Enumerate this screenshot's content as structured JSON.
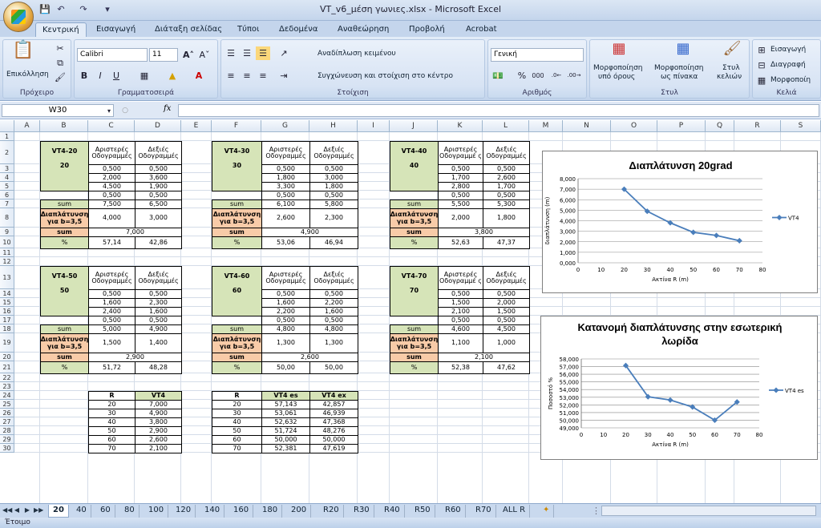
{
  "window": {
    "title": "VT_v6_μέση γωνιες.xlsx - Microsoft Excel"
  },
  "tabs": [
    "Κεντρική",
    "Εισαγωγή",
    "Διάταξη σελίδας",
    "Τύποι",
    "Δεδομένα",
    "Αναθεώρηση",
    "Προβολή",
    "Acrobat"
  ],
  "ribbon": {
    "clipboard": {
      "paste": "Επικόλληση",
      "name": "Πρόχειρο"
    },
    "font": {
      "family": "Calibri",
      "size": "11",
      "name": "Γραμματοσειρά"
    },
    "alignment": {
      "wrap": "Αναδίπλωση κειμένου",
      "merge": "Συγχώνευση και στοίχιση στο κέντρο",
      "name": "Στοίχιση"
    },
    "number": {
      "format": "Γενική",
      "name": "Αριθμός"
    },
    "styles": {
      "cond1": "Μορφοποίηση",
      "cond2": "υπό όρους",
      "table1": "Μορφοποίηση",
      "table2": "ως πίνακα",
      "cell1": "Στυλ",
      "cell2": "κελιών",
      "name": "Στυλ"
    },
    "cells": {
      "insert": "Εισαγωγή",
      "delete": "Διαγραφή",
      "format": "Μορφοποίη",
      "name": "Κελιά"
    }
  },
  "formula_bar": {
    "namebox": "W30",
    "fx": "fx",
    "value": ""
  },
  "columns": [
    "A",
    "B",
    "C",
    "D",
    "E",
    "F",
    "G",
    "H",
    "I",
    "J",
    "K",
    "L",
    "M",
    "N",
    "O",
    "P",
    "Q",
    "R",
    "S"
  ],
  "rows": [
    "1",
    "2",
    "3",
    "4",
    "5",
    "6",
    "7",
    "8",
    "9",
    "10",
    "11",
    "12",
    "13",
    "14",
    "15",
    "16",
    "17",
    "18",
    "19",
    "20",
    "21",
    "22",
    "23",
    "24",
    "25",
    "26",
    "27",
    "28",
    "29",
    "30"
  ],
  "labels": {
    "left": "Αριστερές Οδογραμμές",
    "right": "Δεξιές Οδογραμμές",
    "left_wrap": "Αριστερές Οδογραμμέ ς",
    "sum": "sum",
    "widen": "Διαπλάτυνση για b=3,5",
    "pct": "%"
  },
  "blocks": [
    {
      "name": "VT4-20",
      "r": "20",
      "left": [
        "0,500",
        "2,000",
        "4,500",
        "0,500"
      ],
      "right": [
        "0,500",
        "3,600",
        "1,900",
        "0,500"
      ],
      "sumL": "7,500",
      "sumR": "6,500",
      "wL": "4,000",
      "wR": "3,000",
      "total": "7,000",
      "pL": "57,14",
      "pR": "42,86"
    },
    {
      "name": "VT4-30",
      "r": "30",
      "left": [
        "0,500",
        "1,800",
        "3,300",
        "0,500"
      ],
      "right": [
        "0,500",
        "3,000",
        "1,800",
        "0,500"
      ],
      "sumL": "6,100",
      "sumR": "5,800",
      "wL": "2,600",
      "wR": "2,300",
      "total": "4,900",
      "pL": "53,06",
      "pR": "46,94"
    },
    {
      "name": "VT4-40",
      "r": "40",
      "left": [
        "0,500",
        "1,700",
        "2,800",
        "0,500"
      ],
      "right": [
        "0,500",
        "2,600",
        "1,700",
        "0,500"
      ],
      "sumL": "5,500",
      "sumR": "5,300",
      "wL": "2,000",
      "wR": "1,800",
      "total": "3,800",
      "pL": "52,63",
      "pR": "47,37"
    },
    {
      "name": "VT4-50",
      "r": "50",
      "left": [
        "0,500",
        "1,600",
        "2,400",
        "0,500"
      ],
      "right": [
        "0,500",
        "2,300",
        "1,600",
        "0,500"
      ],
      "sumL": "5,000",
      "sumR": "4,900",
      "wL": "1,500",
      "wR": "1,400",
      "total": "2,900",
      "pL": "51,72",
      "pR": "48,28"
    },
    {
      "name": "VT4-60",
      "r": "60",
      "left": [
        "0,500",
        "1,600",
        "2,200",
        "0,500"
      ],
      "right": [
        "0,500",
        "2,200",
        "1,600",
        "0,500"
      ],
      "sumL": "4,800",
      "sumR": "4,800",
      "wL": "1,300",
      "wR": "1,300",
      "total": "2,600",
      "pL": "50,00",
      "pR": "50,00"
    },
    {
      "name": "VT4-70",
      "r": "70",
      "left": [
        "0,500",
        "1,500",
        "2,100",
        "0,500"
      ],
      "right": [
        "0,500",
        "2,000",
        "1,500",
        "0,500"
      ],
      "sumL": "4,600",
      "sumR": "4,500",
      "wL": "1,100",
      "wR": "1,000",
      "total": "2,100",
      "pL": "52,38",
      "pR": "47,62"
    }
  ],
  "table1": {
    "headers": [
      "R",
      "VT4"
    ],
    "rows": [
      [
        "20",
        "7,000"
      ],
      [
        "30",
        "4,900"
      ],
      [
        "40",
        "3,800"
      ],
      [
        "50",
        "2,900"
      ],
      [
        "60",
        "2,600"
      ],
      [
        "70",
        "2,100"
      ]
    ]
  },
  "table2": {
    "headers": [
      "R",
      "VT4 es",
      "VT4 ex"
    ],
    "rows": [
      [
        "20",
        "57,143",
        "42,857"
      ],
      [
        "30",
        "53,061",
        "46,939"
      ],
      [
        "40",
        "52,632",
        "47,368"
      ],
      [
        "50",
        "51,724",
        "48,276"
      ],
      [
        "60",
        "50,000",
        "50,000"
      ],
      [
        "70",
        "52,381",
        "47,619"
      ]
    ]
  },
  "chart_data": [
    {
      "type": "line",
      "title": "Διαπλάτυνση 20grad",
      "xlabel": "Ακτίνα R (m)",
      "ylabel": "διαπλάτυνση (m)",
      "x": [
        20,
        30,
        40,
        50,
        60,
        70
      ],
      "series": [
        {
          "name": "VT4",
          "values": [
            7.0,
            4.9,
            3.8,
            2.9,
            2.6,
            2.1
          ]
        }
      ],
      "xlim": [
        0,
        80
      ],
      "ylim": [
        0,
        8
      ],
      "xticks": [
        "0",
        "10",
        "20",
        "30",
        "40",
        "50",
        "60",
        "70",
        "80"
      ],
      "yticks": [
        "0,000",
        "1,000",
        "2,000",
        "3,000",
        "4,000",
        "5,000",
        "6,000",
        "7,000",
        "8,000"
      ],
      "grid": true,
      "legend": "right",
      "color": "#4a7ebb"
    },
    {
      "type": "line",
      "title": "Κατανομή διαπλάτυνσης στην εσωτερική λωρίδα",
      "xlabel": "Ακτίνα R (m)",
      "ylabel": "Ποσοστό %",
      "x": [
        20,
        30,
        40,
        50,
        60,
        70
      ],
      "series": [
        {
          "name": "VT4 es",
          "values": [
            57.143,
            53.061,
            52.632,
            51.724,
            50.0,
            52.381
          ]
        }
      ],
      "xlim": [
        0,
        80
      ],
      "ylim": [
        49,
        58
      ],
      "xticks": [
        "0",
        "10",
        "20",
        "30",
        "40",
        "50",
        "60",
        "70",
        "80"
      ],
      "yticks": [
        "49,000",
        "50,000",
        "51,000",
        "52,000",
        "53,000",
        "54,000",
        "55,000",
        "56,000",
        "57,000",
        "58,000"
      ],
      "grid": true,
      "legend": "right",
      "color": "#4a7ebb"
    }
  ],
  "sheet_tabs": [
    "20",
    "40",
    "60",
    "80",
    "100",
    "120",
    "140",
    "160",
    "180",
    "200",
    "R20",
    "R30",
    "R40",
    "R50",
    "R60",
    "R70",
    "ALL R"
  ],
  "status": "Έτοιμο"
}
